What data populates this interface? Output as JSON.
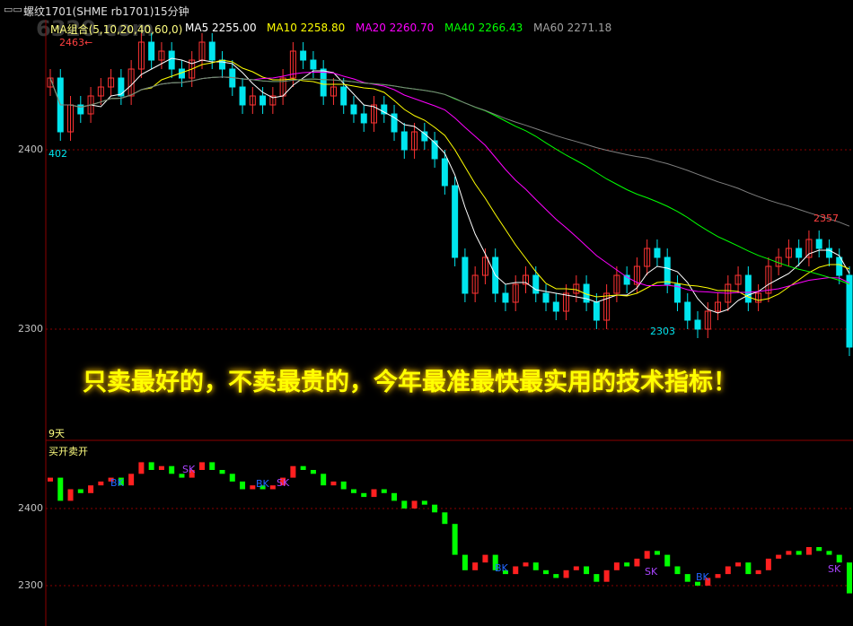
{
  "window": {
    "title": "螺纹1701(SHME rb1701)15分钟",
    "icon": "window-icon"
  },
  "watermark": "6320.com",
  "ma_legend": {
    "group": "MA组合(5,10,20,40,60,0)",
    "items": [
      {
        "label": "MA5 2255.00",
        "color": "#ffffff"
      },
      {
        "label": "MA10 2258.80",
        "color": "#ffff00"
      },
      {
        "label": "MA20 2260.70",
        "color": "#ff00ff"
      },
      {
        "label": "MA40 2266.43",
        "color": "#00ff00"
      },
      {
        "label": "MA60 2271.18",
        "color": "#808080"
      }
    ]
  },
  "main_axis": {
    "labels": [
      "2400",
      "2300"
    ]
  },
  "annotations": {
    "high_left": "2463",
    "low_left": "402",
    "high_right": "2357",
    "low_mid": "2303"
  },
  "banner": "只卖最好的，不卖最贵的，今年最准最快最实用的技术指标！",
  "lower_panel": {
    "period_label": "9天",
    "indicator_name": "买开卖开",
    "axis_labels": [
      "2400",
      "2300"
    ],
    "signals": [
      "BK",
      "SK",
      "BK",
      "SK",
      "BK",
      "SK",
      "BK",
      "SK"
    ]
  },
  "colors": {
    "up": "#ff3333",
    "down": "#00e5ee",
    "grid": "#8b0000",
    "lower_up": "#ff2020",
    "lower_down": "#00ff00"
  },
  "chart_data": {
    "type": "candlestick",
    "ylim": [
      2283,
      2470
    ],
    "closes": [
      2440,
      2410,
      2425,
      2420,
      2430,
      2435,
      2440,
      2430,
      2445,
      2460,
      2450,
      2455,
      2445,
      2440,
      2450,
      2460,
      2450,
      2445,
      2435,
      2425,
      2430,
      2425,
      2430,
      2440,
      2455,
      2450,
      2445,
      2430,
      2435,
      2425,
      2420,
      2415,
      2425,
      2420,
      2410,
      2400,
      2410,
      2405,
      2395,
      2380,
      2340,
      2320,
      2330,
      2340,
      2320,
      2315,
      2325,
      2330,
      2320,
      2315,
      2310,
      2320,
      2325,
      2315,
      2305,
      2320,
      2330,
      2325,
      2335,
      2345,
      2340,
      2325,
      2315,
      2305,
      2300,
      2310,
      2315,
      2325,
      2330,
      2315,
      2320,
      2335,
      2340,
      2345,
      2340,
      2350,
      2345,
      2340,
      2330,
      2290
    ]
  }
}
